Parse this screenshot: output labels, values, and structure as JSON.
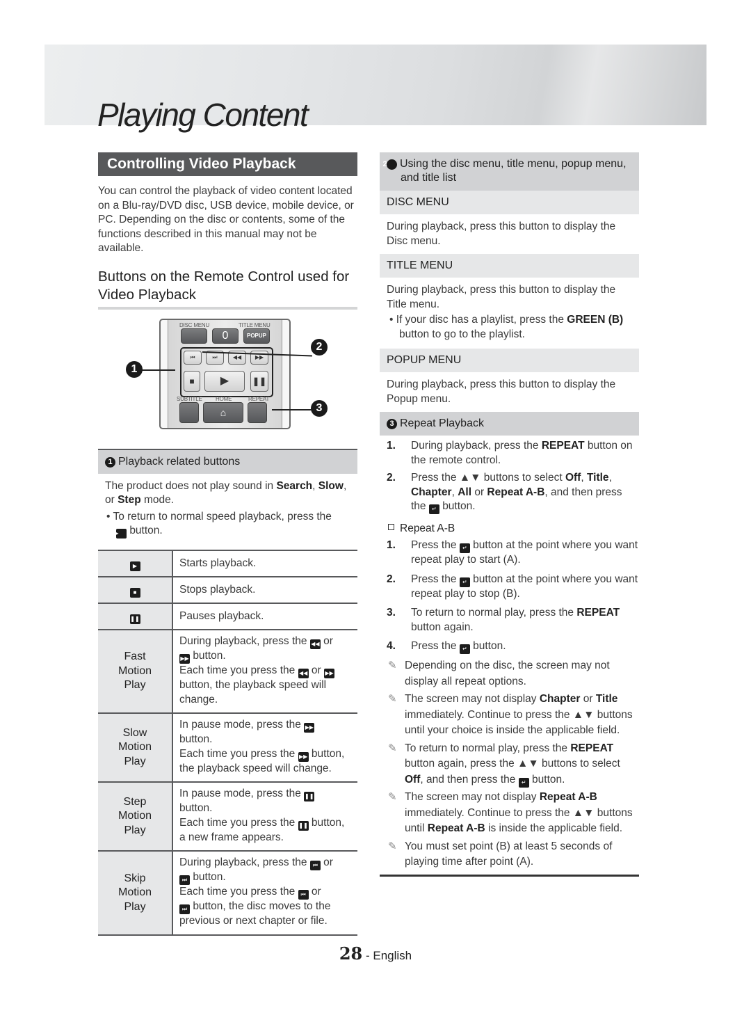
{
  "banner": {
    "title": "Playing Content"
  },
  "left": {
    "section_title": "Controlling Video Playback",
    "intro": "You can control the playback of video content located on a Blu-ray/DVD disc, USB device, mobile device, or PC. Depending on the disc or contents, some of the functions described in this manual may not be available.",
    "subheading": "Buttons on the Remote Control used for Video Playback",
    "remote": {
      "labels": {
        "disc_menu": "DISC MENU",
        "title_menu": "TITLE MENU",
        "zero": "0",
        "popup": "POPUP",
        "subtitle": "SUBTITLE",
        "home": "HOME",
        "repeat": "REPEAT"
      },
      "callouts": [
        "1",
        "2",
        "3"
      ]
    },
    "playback_box": {
      "number": "1",
      "title": "Playback related buttons",
      "note_pre": "The product does not play sound in ",
      "note_b1": "Search",
      "note_sep1": ", ",
      "note_b2": "Slow",
      "note_sep2": ", or ",
      "note_b3": "Step",
      "note_post": " mode.",
      "bullet_pre": "To return to normal speed playback, press the",
      "bullet_post": "button."
    },
    "table": [
      {
        "key_icon": "play-icon",
        "desc": "Starts playback."
      },
      {
        "key_icon": "stop-icon",
        "desc": "Stops playback."
      },
      {
        "key_icon": "pause-icon",
        "desc": "Pauses playback."
      },
      {
        "key": "Fast Motion Play",
        "l1a": "During playback, press the",
        "l1b": "or",
        "l1c": "button.",
        "l2a": "Each time you press the",
        "l2b": "or",
        "l2c": "button, the playback speed will change."
      },
      {
        "key": "Slow Motion Play",
        "l1a": "In pause mode, press the",
        "l1c": "button.",
        "l2a": "Each time you press the",
        "l2c": "button, the playback speed will change."
      },
      {
        "key": "Step Motion Play",
        "l1a": "In pause mode, press the",
        "l1c": "button.",
        "l2a": "Each time you press the",
        "l2c": "button, a new frame appears."
      },
      {
        "key": "Skip Motion Play",
        "l1a": "During playback, press the",
        "l1b": "or",
        "l1c": "button.",
        "l2a": "Each time you press the",
        "l2b": "or",
        "l2c": "button, the disc moves to the previous or next chapter or file."
      }
    ]
  },
  "right": {
    "menu_box": {
      "number": "2",
      "title": "Using the disc menu, title menu, popup menu, and title list"
    },
    "disc_menu": {
      "header": "DISC MENU",
      "desc": "During playback, press this button to display the Disc menu."
    },
    "title_menu": {
      "header": "TITLE MENU",
      "desc": "During playback, press this button to display the Title menu.",
      "bullet_pre": "If your disc has a playlist, press the ",
      "bullet_bold": "GREEN (B)",
      "bullet_post": " button to go to the playlist."
    },
    "popup_menu": {
      "header": "POPUP MENU",
      "desc": "During playback, press this button to display the Popup menu."
    },
    "repeat_box": {
      "number": "3",
      "title": "Repeat Playback"
    },
    "repeat_steps": {
      "s1_n": "1.",
      "s1_pre": "During playback, press the ",
      "s1_b": "REPEAT",
      "s1_post": " button on the remote control.",
      "s2_n": "2.",
      "s2_pre": "Press the ▲▼ buttons to select ",
      "s2_b1": "Off",
      "s2_c1": ", ",
      "s2_b2": "Title",
      "s2_c2": ", ",
      "s2_b3": "Chapter",
      "s2_c3": ", ",
      "s2_b4": "All",
      "s2_c4": " or ",
      "s2_b5": "Repeat A-B",
      "s2_post": ", and then press the",
      "s2_end": "button."
    },
    "repeat_ab": {
      "title": "Repeat A-B",
      "s1_n": "1.",
      "s1_pre": "Press the",
      "s1_post": "button at the point where you want repeat play to start (A).",
      "s2_n": "2.",
      "s2_pre": "Press the",
      "s2_post": "button at the point where you want repeat play to stop (B).",
      "s3_n": "3.",
      "s3_pre": "To return to normal play, press the ",
      "s3_b": "REPEAT",
      "s3_post": " button again.",
      "s4_n": "4.",
      "s4_pre": "Press the",
      "s4_post": "button."
    },
    "notes": {
      "n1": "Depending on the disc, the screen may not display all repeat options.",
      "n2_pre": "The screen may not display ",
      "n2_b1": "Chapter",
      "n2_mid": " or ",
      "n2_b2": "Title",
      "n2_post": " immediately. Continue to press the ▲▼ buttons until your choice is inside the applicable field.",
      "n3_pre": "To return to normal play, press the ",
      "n3_b1": "REPEAT",
      "n3_mid": " button again, press the ▲▼ buttons to select ",
      "n3_b2": "Off",
      "n3_mid2": ", and then press the",
      "n3_post": "button.",
      "n4_pre": "The screen may not display ",
      "n4_b1": "Repeat A-B",
      "n4_mid": " immediately. Continue to press the ▲▼ buttons until ",
      "n4_b2": "Repeat A-B",
      "n4_post": " is inside the applicable field.",
      "n5": "You must set point (B) at least 5 seconds of playing time after point (A)."
    }
  },
  "footer": {
    "page_number": "28",
    "separator": " - ",
    "language": "English"
  }
}
